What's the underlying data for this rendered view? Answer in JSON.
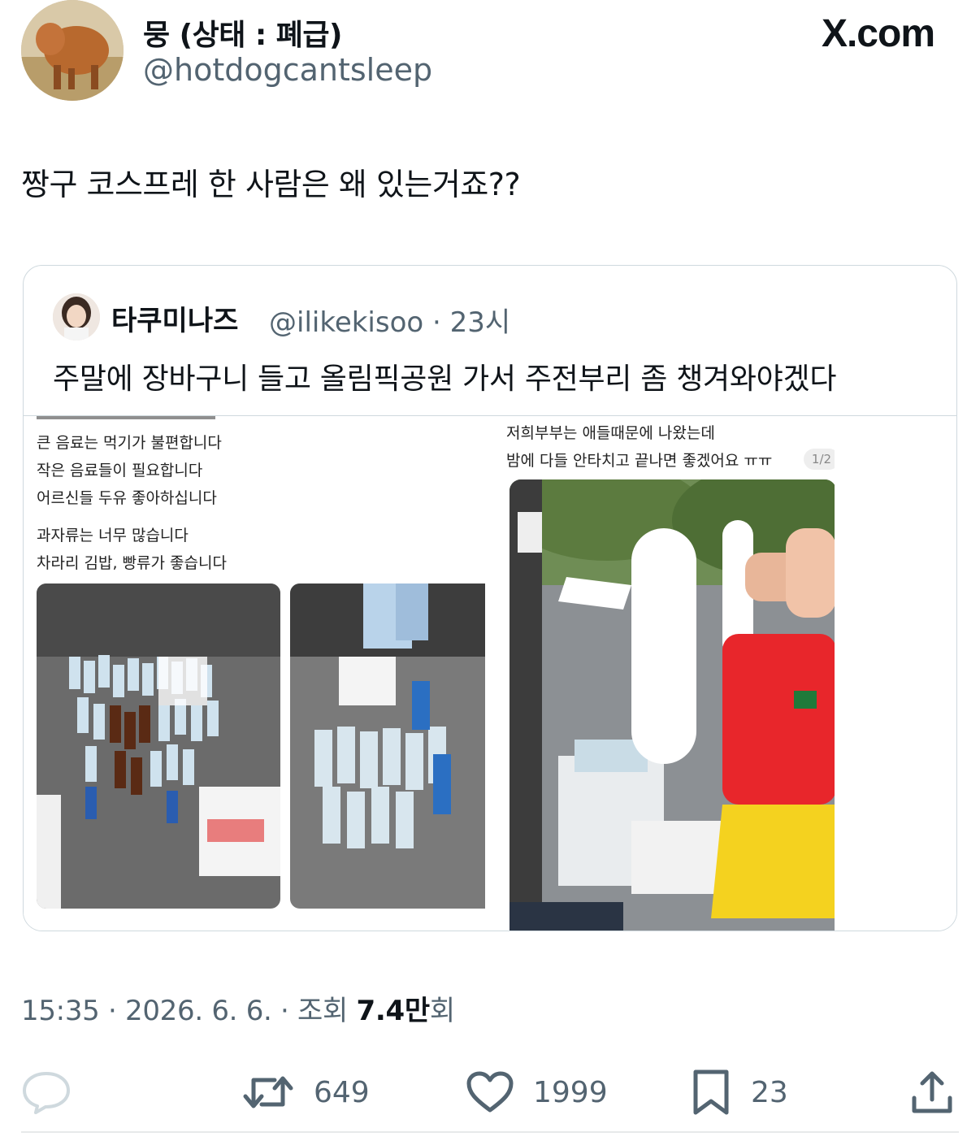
{
  "tweet": {
    "display_name": "뭉 (상태 : 폐급)",
    "handle": "@hotdogcantsleep",
    "text": "짱구 코스프레 한 사람은 왜 있는거죠??",
    "brand": "X.com"
  },
  "quote": {
    "display_name": "타쿠미나즈",
    "handle": "@ilikekisoo · 23시",
    "text": "주말에 장바구니 들고 올림픽공원 가서 주전부리 좀 챙겨와야겠다",
    "media": {
      "left_lines": [
        "큰 음료는 먹기가 불편합니다",
        "작은 음료들이 필요합니다",
        "어르신들 두유 좋아하십니다",
        "과자류는 너무 많습니다",
        "차라리 김밥, 빵류가 좋습니다"
      ],
      "right_lines": [
        "저희부부는 애들때문에 나왔는데",
        "밤에 다들 안타치고 끝나면 좋겠어요 ㅠㅠ"
      ],
      "page_badge": "1/2"
    }
  },
  "meta": {
    "time_date": "15:35 · 2026. 6. 6. · 조회 ",
    "views": "7.4만",
    "views_suffix": "회"
  },
  "actions": {
    "reply_count": "",
    "retweet_count": "649",
    "like_count": "1999",
    "bookmark_count": "23"
  },
  "colors": {
    "text": "#0f1419",
    "secondary": "#536471",
    "border": "#cfd9de"
  }
}
